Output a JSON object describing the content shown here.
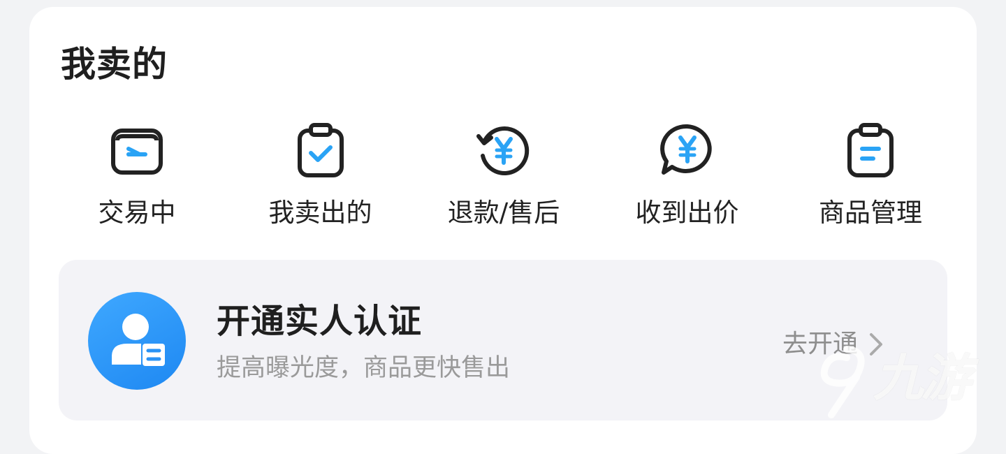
{
  "section": {
    "title": "我卖的"
  },
  "shortcuts": [
    {
      "label": "交易中",
      "icon": "in-transaction-icon"
    },
    {
      "label": "我卖出的",
      "icon": "sold-clipboard-icon"
    },
    {
      "label": "退款/售后",
      "icon": "refund-yen-icon"
    },
    {
      "label": "收到出价",
      "icon": "offer-chat-yen-icon"
    },
    {
      "label": "商品管理",
      "icon": "product-manage-clipboard-icon"
    }
  ],
  "verify_banner": {
    "title": "开通实人认证",
    "subtitle": "提高曝光度，商品更快售出",
    "action_label": "去开通",
    "icon": "verified-user-icon"
  },
  "watermark": {
    "text": "九游"
  },
  "colors": {
    "accent": "#2aa3f5",
    "icon_stroke": "#222222",
    "banner_bg": "#f3f3f7",
    "avatar_blue": "#2a93f5"
  }
}
